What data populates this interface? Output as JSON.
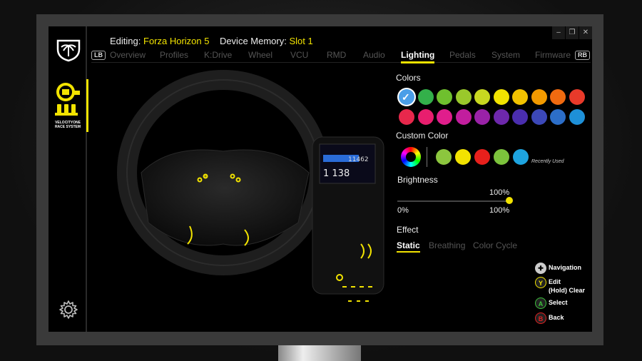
{
  "header": {
    "editing_label": "Editing:",
    "editing_value": "Forza Horizon 5",
    "memory_label": "Device Memory:",
    "memory_value": "Slot 1"
  },
  "window_controls": {
    "minimize": "–",
    "restore": "❐",
    "close": "✕"
  },
  "sidebar": {
    "device_name_line1": "VELOCITYONE",
    "device_name_line2": "RACE SYSTEM"
  },
  "tabs": {
    "left_bumper": "LB",
    "right_bumper": "RB",
    "items": [
      "Overview",
      "Profiles",
      "K:Drive",
      "Wheel",
      "VCU",
      "RMD",
      "Audio",
      "Lighting",
      "Pedals",
      "System",
      "Firmware"
    ],
    "active": "Lighting"
  },
  "lighting": {
    "colors_title": "Colors",
    "color_swatches_row1": [
      "#4a9ee8",
      "#33b04a",
      "#6fc02e",
      "#9ac82b",
      "#c8d820",
      "#f2e300",
      "#f2c200",
      "#f29a00",
      "#f06a10",
      "#e83a2a"
    ],
    "color_swatches_row2": [
      "#e8284c",
      "#e81e6e",
      "#e01e8c",
      "#c21e9e",
      "#9a22a8",
      "#6e28ac",
      "#4a2eae",
      "#3c48b8",
      "#2c6ec8",
      "#1e90d8"
    ],
    "selected_color": "#4a9ee8",
    "custom_color_title": "Custom Color",
    "recently_used": [
      "#8cc63e",
      "#f2e300",
      "#e8201c",
      "#7cc33c",
      "#1ea4e0"
    ],
    "recently_used_label": "Recently Used",
    "brightness_title": "Brightness",
    "brightness_value": "100%",
    "brightness_min": "0%",
    "brightness_max": "100%",
    "brightness_level": 1.0,
    "effect_title": "Effect",
    "effects": [
      "Static",
      "Breathing",
      "Color Cycle"
    ],
    "active_effect": "Static"
  },
  "controls_legend": [
    {
      "button": "✚",
      "label": "Navigation",
      "color": "#cccccc"
    },
    {
      "button": "Y",
      "label": "Edit",
      "label2": "(Hold) Clear",
      "color": "#f2e300"
    },
    {
      "button": "A",
      "label": "Select",
      "color": "#3cc03c"
    },
    {
      "button": "B",
      "label": "Back",
      "color": "#e02020"
    }
  ]
}
